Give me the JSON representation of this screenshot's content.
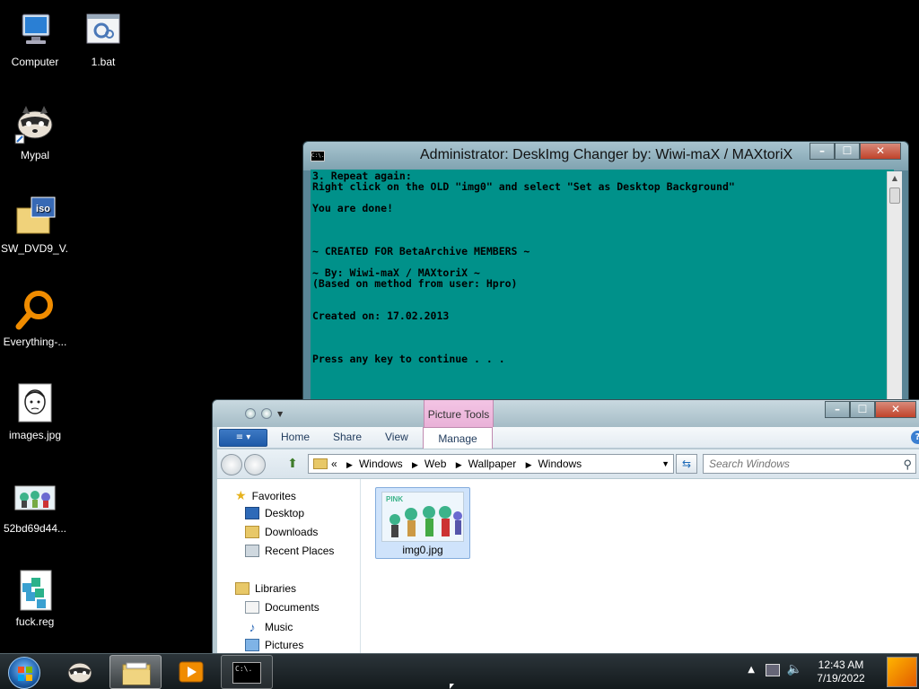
{
  "desktop_icons": [
    {
      "label": "Computer",
      "icon": "computer-icon"
    },
    {
      "label": "1.bat",
      "icon": "batch-file-icon"
    },
    {
      "label": "Mypal",
      "icon": "mypal-raccoon-icon"
    },
    {
      "label": "SW_DVD9_V...",
      "icon": "iso-file-icon"
    },
    {
      "label": "Everything-...",
      "icon": "everything-search-icon"
    },
    {
      "label": "images.jpg",
      "icon": "image-file-icon"
    },
    {
      "label": "52bd69d44...",
      "icon": "image-file-icon"
    },
    {
      "label": "fuck.reg",
      "icon": "registry-file-icon"
    }
  ],
  "console": {
    "title": "Administrator:  DeskImg Changer by: Wiwi-maX / MAXtoriX",
    "icon_text": "C:\\.",
    "lines": [
      "3. Repeat again:",
      "Right click on the OLD \"img0\" and select \"Set as Desktop Background\"",
      "",
      "You are done!",
      "",
      "",
      "",
      "~ CREATED FOR BetaArchive MEMBERS ~",
      "",
      "~ By: Wiwi-maX / MAXtoriX ~",
      "(Based on method from user: Hpro)",
      "",
      "",
      "Created on: 17.02.2013",
      "",
      "",
      "",
      "Press any key to continue . . ."
    ],
    "bg_color": "#00918a"
  },
  "explorer": {
    "context_tab": "Picture Tools",
    "file_button": "≡",
    "tabs": {
      "home": "Home",
      "share": "Share",
      "view": "View",
      "manage": "Manage"
    },
    "address": {
      "prefix": "«",
      "crumbs": [
        "Windows",
        "Web",
        "Wallpaper",
        "Windows"
      ]
    },
    "search_placeholder": "Search Windows",
    "nav": {
      "favorites": "Favorites",
      "desktop": "Desktop",
      "downloads": "Downloads",
      "recent": "Recent Places",
      "libraries": "Libraries",
      "documents": "Documents",
      "music": "Music",
      "pictures": "Pictures"
    },
    "file": {
      "name": "img0.jpg"
    }
  },
  "taskbar": {
    "clock_time": "12:43 AM",
    "clock_date": "7/19/2022",
    "console_icon_text": "C:\\."
  }
}
